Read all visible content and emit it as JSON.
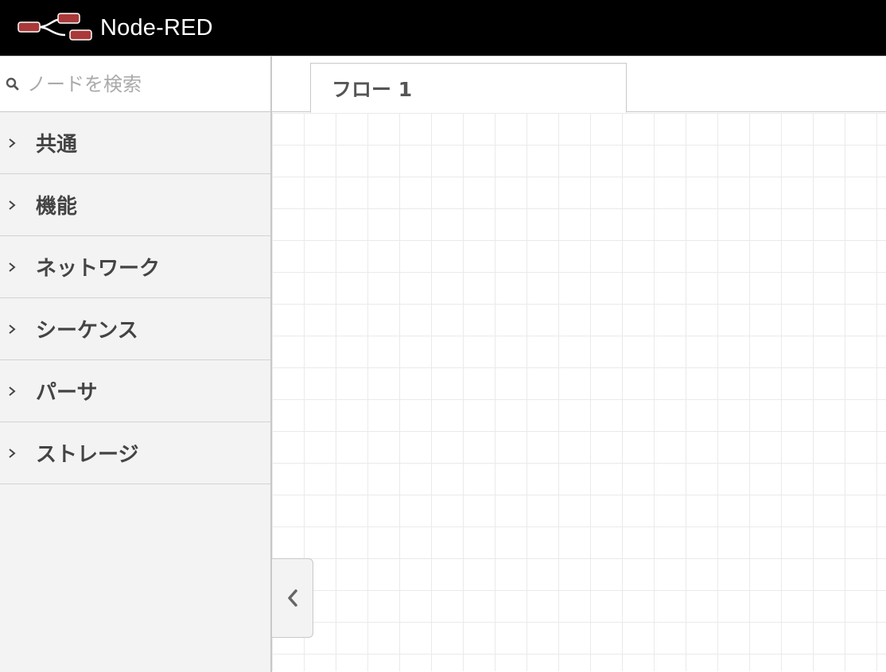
{
  "header": {
    "app_title": "Node-RED",
    "logo_icon": "node-red-logo-icon",
    "logo_color": "#aa3939"
  },
  "palette": {
    "search": {
      "icon": "search-icon",
      "placeholder": "ノードを検索",
      "value": ""
    },
    "categories": [
      {
        "label": "共通",
        "icon": "chevron-right-icon"
      },
      {
        "label": "機能",
        "icon": "chevron-right-icon"
      },
      {
        "label": "ネットワーク",
        "icon": "chevron-right-icon"
      },
      {
        "label": "シーケンス",
        "icon": "chevron-right-icon"
      },
      {
        "label": "パーサ",
        "icon": "chevron-right-icon"
      },
      {
        "label": "ストレージ",
        "icon": "chevron-right-icon"
      }
    ]
  },
  "workspace": {
    "tabs": [
      {
        "label": "フロー 1",
        "active": true
      }
    ],
    "palette_toggle_icon": "chevron-left-icon"
  }
}
